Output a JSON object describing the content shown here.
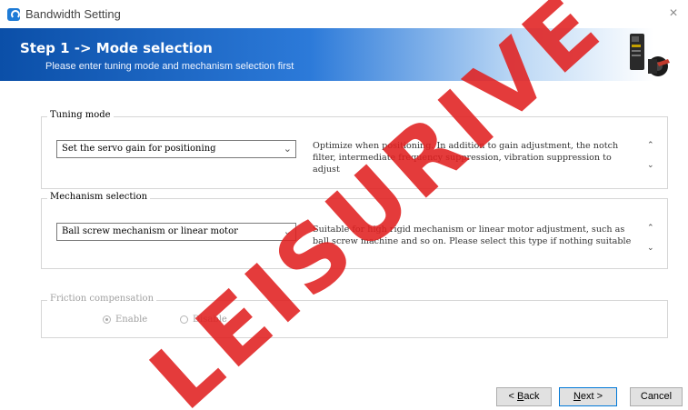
{
  "window": {
    "title": "Bandwidth Setting",
    "close_glyph": "×"
  },
  "banner": {
    "step_title": "Step 1 -> Mode selection",
    "subtitle": "Please enter tuning mode and mechanism selection first"
  },
  "tuning_mode": {
    "legend": "Tuning mode",
    "selected": "Set the servo gain for positioning",
    "description": "Optimize when positioning. In addition to gain adjustment, the notch filter, intermediate frequency suppression, vibration suppression to adjust"
  },
  "mechanism": {
    "legend": "Mechanism selection",
    "selected": "Ball screw mechanism or linear motor",
    "description": "Suitable for high rigid mechanism or linear motor adjustment, such as ball screw machine and so on. Please select this type if nothing suitable"
  },
  "friction": {
    "legend": "Friction compensation",
    "options": [
      {
        "label": "Enable",
        "checked": true
      },
      {
        "label": "Disable",
        "checked": false
      }
    ]
  },
  "footer": {
    "back_prefix": "< ",
    "back_key": "B",
    "back_rest": "ack",
    "next_key": "N",
    "next_rest": "ext >",
    "cancel_label": "Cancel"
  },
  "watermark": {
    "text": "LEISURIVE",
    "color": "#e02020"
  }
}
